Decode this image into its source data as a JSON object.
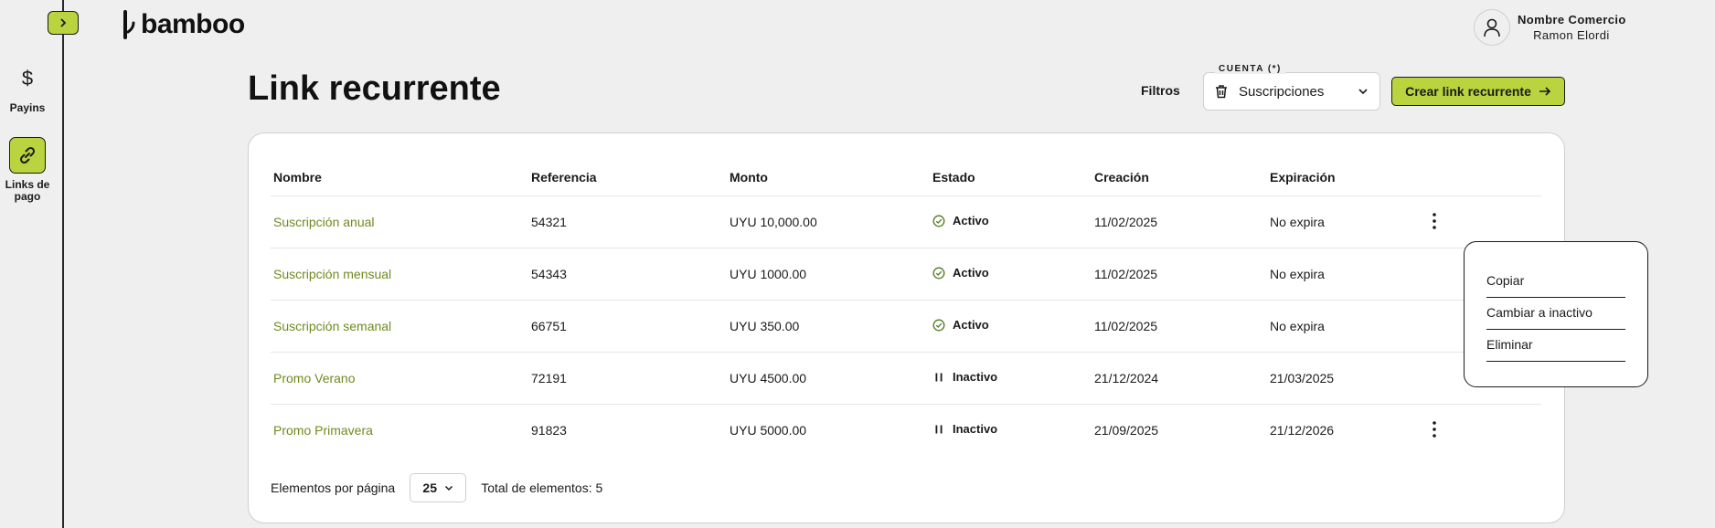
{
  "sidebar": {
    "items": [
      {
        "label": "Payins",
        "icon": "dollar-icon"
      },
      {
        "label": "Links de pago",
        "icon": "link-icon"
      }
    ]
  },
  "header": {
    "brand": "bamboo",
    "user_name": "Nombre Comercio",
    "user_sub": "Ramon Elordi"
  },
  "page": {
    "title": "Link recurrente",
    "filters_label": "Filtros",
    "account_legend": "CUENTA (*)",
    "account_value": "Suscripciones",
    "create_button": "Crear link recurrente"
  },
  "table": {
    "headers": [
      "Nombre",
      "Referencia",
      "Monto",
      "Estado",
      "Creación",
      "Expiración"
    ],
    "rows": [
      {
        "name": "Suscripción anual",
        "ref": "54321",
        "amount": "UYU 10,000.00",
        "status": "Activo",
        "created": "11/02/2025",
        "expires": "No expira"
      },
      {
        "name": "Suscripción mensual",
        "ref": "54343",
        "amount": "UYU 1000.00",
        "status": "Activo",
        "created": "11/02/2025",
        "expires": "No expira"
      },
      {
        "name": "Suscripción semanal",
        "ref": "66751",
        "amount": "UYU 350.00",
        "status": "Activo",
        "created": "11/02/2025",
        "expires": "No expira"
      },
      {
        "name": "Promo Verano",
        "ref": "72191",
        "amount": "UYU 4500.00",
        "status": "Inactivo",
        "created": "21/12/2024",
        "expires": "21/03/2025"
      },
      {
        "name": "Promo Primavera",
        "ref": "91823",
        "amount": "UYU 5000.00",
        "status": "Inactivo",
        "created": "21/09/2025",
        "expires": "21/12/2026"
      }
    ]
  },
  "pagination": {
    "per_page_label": "Elementos por página",
    "per_page_value": "25",
    "total_label": "Total de elementos: 5"
  },
  "context_menu": {
    "items": [
      "Copiar",
      "Cambiar a inactivo",
      "Eliminar"
    ]
  },
  "colors": {
    "accent": "#b9d43f",
    "link_text": "#6f8a1f",
    "background": "#f0efef"
  }
}
